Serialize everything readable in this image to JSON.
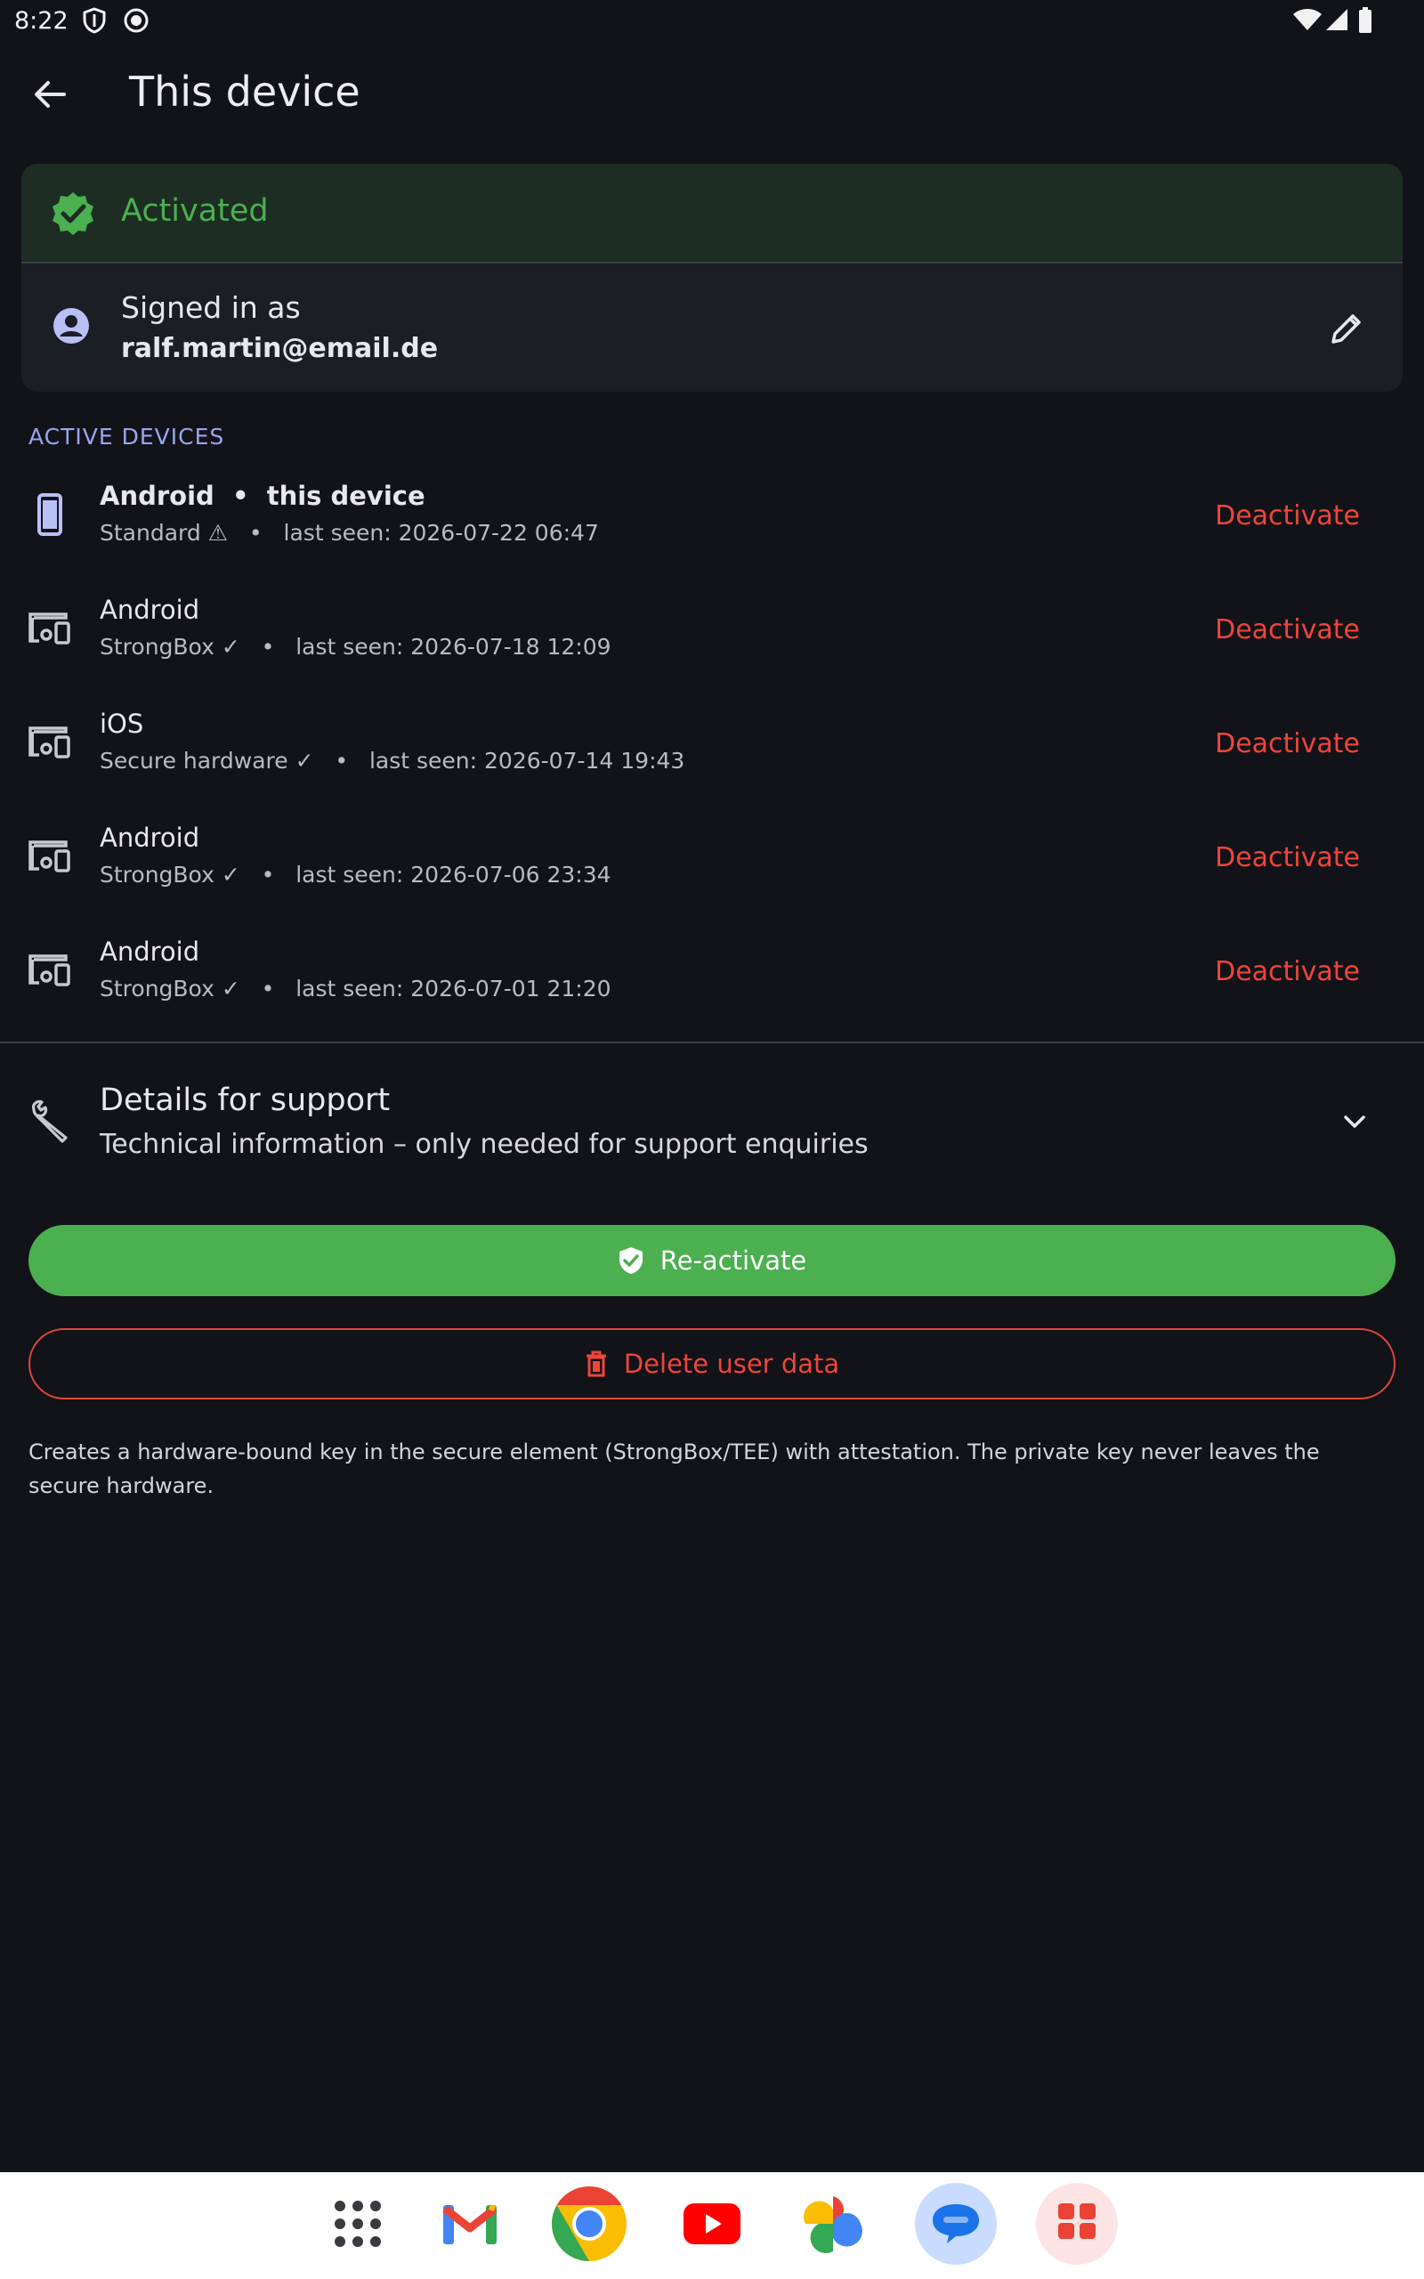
{
  "status_bar": {
    "time": "8:22"
  },
  "app_bar": {
    "title": "This device"
  },
  "account_card": {
    "activated_label": "Activated",
    "signed_in_label": "Signed in as",
    "email": "ralf.martin@email.de"
  },
  "section": {
    "active_devices_header": "ACTIVE DEVICES"
  },
  "devices": [
    {
      "name": "Android",
      "suffix": "this device",
      "security": "Standard ⚠",
      "last_seen": "last seen: 2026-07-22 06:47",
      "action": "Deactivate"
    },
    {
      "name": "Android",
      "security": "StrongBox ✓",
      "last_seen": "last seen: 2026-07-18 12:09",
      "action": "Deactivate"
    },
    {
      "name": "iOS",
      "security": "Secure hardware ✓",
      "last_seen": "last seen: 2026-07-14 19:43",
      "action": "Deactivate"
    },
    {
      "name": "Android",
      "security": "StrongBox ✓",
      "last_seen": "last seen: 2026-07-06 23:34",
      "action": "Deactivate"
    },
    {
      "name": "Android",
      "security": "StrongBox ✓",
      "last_seen": "last seen: 2026-07-01 21:20",
      "action": "Deactivate"
    }
  ],
  "support": {
    "title": "Details for support",
    "subtitle": "Technical information – only needed for support enquiries"
  },
  "buttons": {
    "reactivate": "Re-activate",
    "delete": "Delete user data"
  },
  "footnote": "Creates a hardware-bound key in the secure element (StrongBox/TEE) with attestation. The private key never leaves the secure hardware.",
  "dock": {
    "apps": [
      "app-drawer-icon",
      "gmail-icon",
      "chrome-icon",
      "youtube-icon",
      "photos-icon",
      "messages-icon",
      "play-store-icon"
    ]
  },
  "colors": {
    "background": "#121319",
    "accent_green": "#4caf50",
    "danger_red": "#f0443a",
    "section_blue": "#9aa6ee"
  }
}
